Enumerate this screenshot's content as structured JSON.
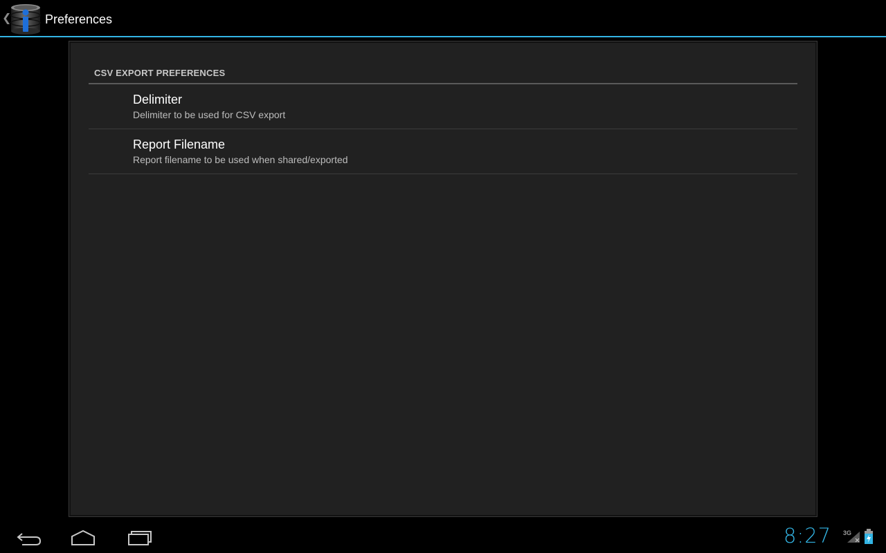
{
  "action_bar": {
    "title": "Preferences",
    "icon": "database-info-icon",
    "up_icon": "chevron-left-icon"
  },
  "preferences": {
    "category_title": "CSV EXPORT PREFERENCES",
    "items": [
      {
        "title": "Delimiter",
        "summary": "Delimiter to be used for CSV export"
      },
      {
        "title": "Report Filename",
        "summary": "Report filename to be used when shared/exported"
      }
    ]
  },
  "system_bar": {
    "clock": "8:27",
    "network_type": "3G",
    "icons": [
      "back-icon",
      "home-icon",
      "recents-icon",
      "signal-icon",
      "battery-charging-icon"
    ]
  },
  "colors": {
    "accent": "#33b5e5",
    "background": "#000000",
    "panel": "#212121",
    "app_icon_blue": "#1e6fd9"
  }
}
